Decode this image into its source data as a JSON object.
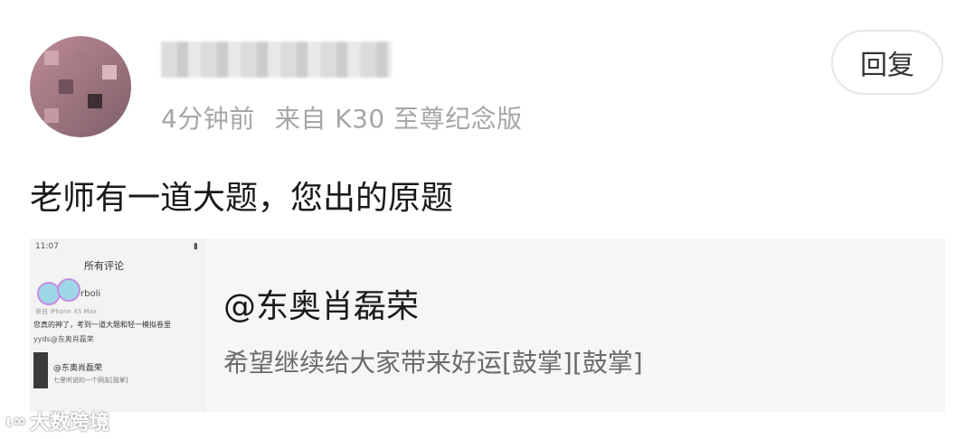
{
  "post": {
    "time_ago": "4分钟前",
    "source": "来自 K30 至尊纪念版",
    "reply_label": "回复",
    "comment_text": "老师有一道大题，您出的原题"
  },
  "quoted": {
    "title": "@东奥肖磊荣",
    "text": "希望继续给大家带来好运[鼓掌][鼓掌]",
    "thumbnail": {
      "status_time": "11:07",
      "screen_title": "所有评论",
      "user": "rboli",
      "device": "来自 iPhone XS Max",
      "line1": "您真的神了，考到一道大题和轻一模拟卷里",
      "line2": "yyds@东奥肖磊荣",
      "mention": "@东奥肖磊荣",
      "reply": "七里听说的一个网友[鼓掌]"
    }
  },
  "watermark": {
    "text": "大数跨境",
    "logo": "ɩ∞"
  },
  "colors": {
    "meta_gray": "#a6a6a6",
    "card_bg": "#f6f6f6",
    "text_dark": "#1a1a1a"
  }
}
